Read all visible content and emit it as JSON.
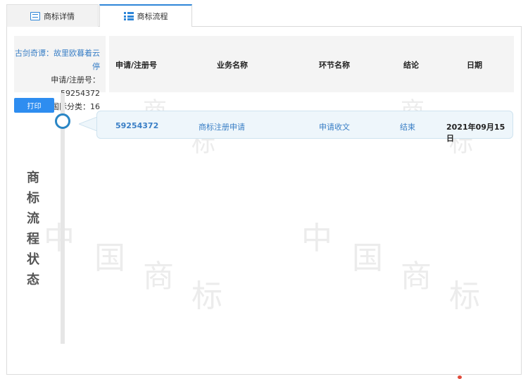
{
  "tabs": [
    {
      "label": "商标详情",
      "icon": "document-icon"
    },
    {
      "label": "商标流程",
      "icon": "list-icon",
      "active": true
    }
  ],
  "info": {
    "trademark_name": "古剑奇谭：故里欧暮着云停",
    "reg_line": "申请/注册号：59254372",
    "class_line": "国际分类：16"
  },
  "print_label": "打印",
  "table": {
    "columns": [
      "申请/注册号",
      "业务名称",
      "环节名称",
      "结论",
      "日期"
    ],
    "rows": [
      {
        "reg_no": "59254372",
        "business": "商标注册申请",
        "step": "申请收文",
        "result": "结束",
        "date": "2021年09月15日"
      }
    ]
  },
  "side_title": [
    "商",
    "标",
    "流",
    "程",
    "状",
    "态"
  ],
  "watermark": [
    "中",
    "国",
    "商",
    "标"
  ],
  "colors": {
    "accent": "#2e86d8",
    "button": "#2e8df0",
    "link": "#3a7fc6"
  }
}
